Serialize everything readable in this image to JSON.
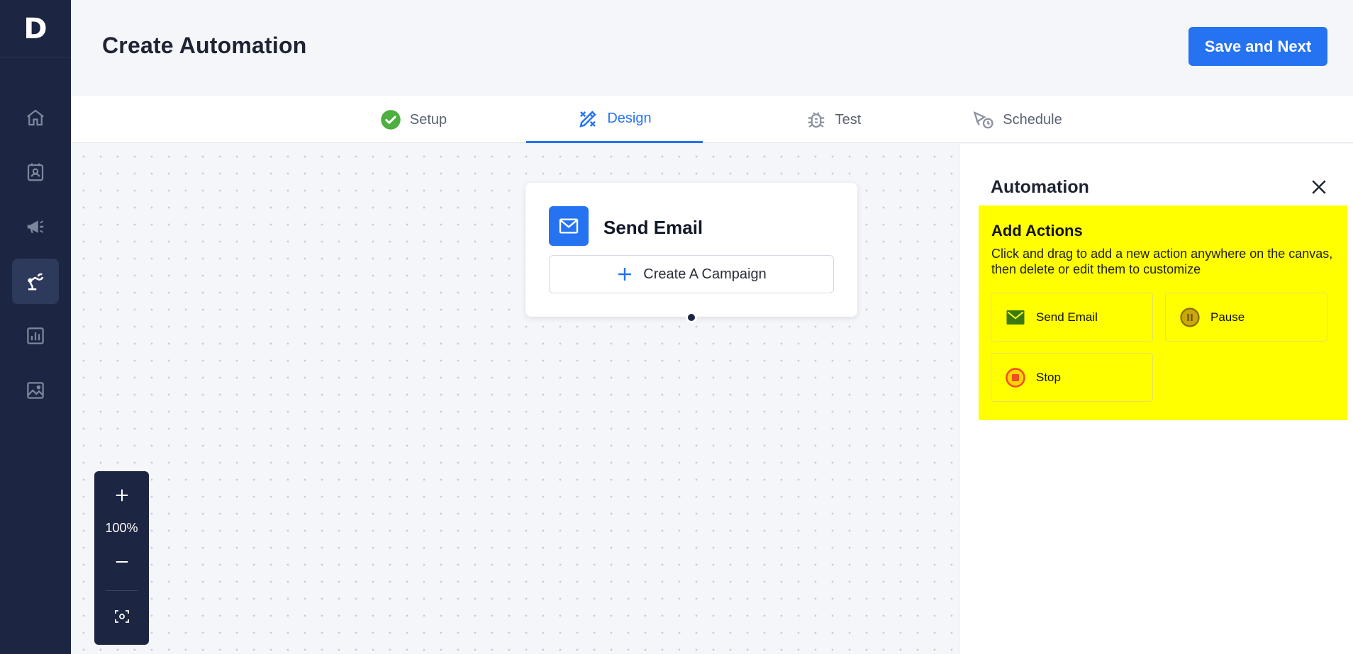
{
  "app": {
    "logo_text": "D",
    "brand_color": "#2573f0",
    "sidebar_color": "#1c2541"
  },
  "sidebar": {
    "items": [
      {
        "icon": "home-icon",
        "active": false
      },
      {
        "icon": "contacts-icon",
        "active": false
      },
      {
        "icon": "megaphone-icon",
        "active": false
      },
      {
        "icon": "automation-robot-arm-icon",
        "active": true
      },
      {
        "icon": "reports-chart-icon",
        "active": false
      },
      {
        "icon": "image-gallery-icon",
        "active": false
      }
    ]
  },
  "header": {
    "title": "Create Automation",
    "save_label": "Save and Next"
  },
  "tabs": [
    {
      "label": "Setup",
      "icon": "check-circle-icon",
      "state": "complete"
    },
    {
      "label": "Design",
      "icon": "design-tools-icon",
      "state": "active"
    },
    {
      "label": "Test",
      "icon": "bug-icon",
      "state": "pending"
    },
    {
      "label": "Schedule",
      "icon": "schedule-clock-icon",
      "state": "pending"
    }
  ],
  "canvas": {
    "node": {
      "title": "Send Email",
      "icon": "envelope-icon",
      "button_label": "Create A Campaign"
    },
    "zoom": {
      "level": "100%",
      "zoom_in_icon": "plus-icon",
      "zoom_out_icon": "minus-icon",
      "fit_icon": "fit-view-icon"
    }
  },
  "panel": {
    "title": "Automation",
    "actions_title": "Add Actions",
    "actions_description": "Click and drag to add a new action anywhere on the canvas, then delete or edit them to customize",
    "highlight_color": "#ffff00",
    "actions": [
      {
        "label": "Send Email",
        "icon": "envelope-icon",
        "color": "#3a7a16"
      },
      {
        "label": "Pause",
        "icon": "pause-circle-icon",
        "color": "#9a7a0a"
      },
      {
        "label": "Stop",
        "icon": "stop-circle-icon",
        "color": "#f04e23"
      }
    ]
  }
}
